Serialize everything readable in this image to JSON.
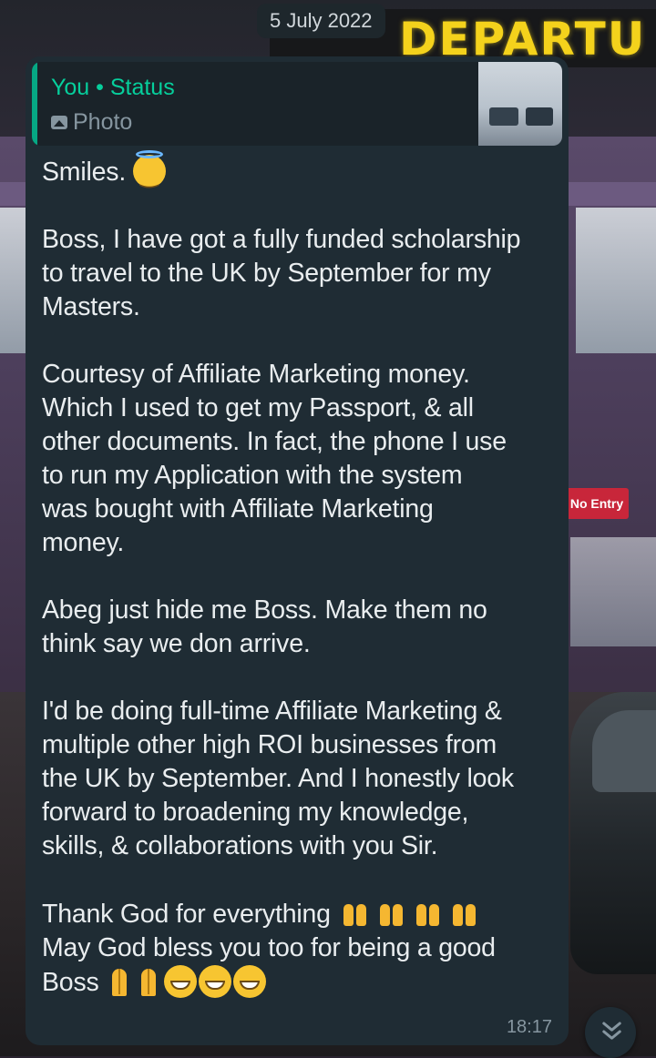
{
  "chat": {
    "date_chip": "5 July 2022"
  },
  "background": {
    "sign_text": "DEPARTU",
    "red_sign_text": "No Entry"
  },
  "message": {
    "quoted": {
      "author": "You • Status",
      "type": "Photo",
      "type_icon": "photo-icon"
    },
    "paragraphs": [
      {
        "text": "Smiles.",
        "emoji": [
          "smiling-face-with-halo"
        ]
      },
      {
        "text": "Boss, I have got a fully funded scholarship\nto travel to the UK by September for my\nMasters."
      },
      {
        "text": "Courtesy of Affiliate Marketing money.\nWhich I used to get my Passport, & all\nother documents. In fact, the phone I use\nto run my Application with the system\nwas bought with Affiliate Marketing\nmoney."
      },
      {
        "text": "Abeg just hide me Boss. Make them no\nthink say we don arrive."
      },
      {
        "text": "I'd be doing full-time Affiliate Marketing &\nmultiple other high ROI businesses from\nthe UK by September. And I honestly look\nforward to broadening my knowledge,\nskills, & collaborations with you Sir."
      },
      {
        "text": "Thank God for everything",
        "emoji": [
          "raising-hands",
          "raising-hands",
          "raising-hands",
          "raising-hands"
        ]
      },
      {
        "text": "May God bless you too for being a good\nBoss",
        "emoji": [
          "folded-hands",
          "folded-hands",
          "grinning-face",
          "grinning-face",
          "grinning-face"
        ]
      }
    ],
    "time": "18:17"
  },
  "scroll_button": {
    "icon": "chevron-double-down-icon"
  },
  "colors": {
    "bubble": "#1f2c34",
    "text": "#e9edef",
    "meta": "#8696a0",
    "accent": "#06cf9c"
  }
}
